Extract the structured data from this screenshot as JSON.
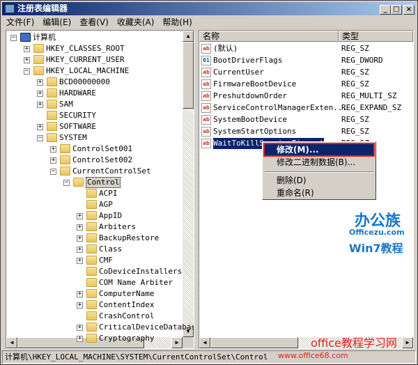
{
  "window": {
    "title": "注册表编辑器",
    "minimize": "_",
    "maximize": "□",
    "close": "×"
  },
  "menu": [
    "文件(F)",
    "编辑(E)",
    "查看(V)",
    "收藏夹(A)",
    "帮助(H)"
  ],
  "tree": [
    {
      "label": "计算机",
      "level": 0,
      "exp": "-",
      "type": "computer"
    },
    {
      "label": "HKEY_CLASSES_ROOT",
      "level": 1,
      "exp": "+"
    },
    {
      "label": "HKEY_CURRENT_USER",
      "level": 1,
      "exp": "+"
    },
    {
      "label": "HKEY_LOCAL_MACHINE",
      "level": 1,
      "exp": "-"
    },
    {
      "label": "BCD00000000",
      "level": 2,
      "exp": "+"
    },
    {
      "label": "HARDWARE",
      "level": 2,
      "exp": "+"
    },
    {
      "label": "SAM",
      "level": 2,
      "exp": "+"
    },
    {
      "label": "SECURITY",
      "level": 2,
      "exp": ""
    },
    {
      "label": "SOFTWARE",
      "level": 2,
      "exp": "+"
    },
    {
      "label": "SYSTEM",
      "level": 2,
      "exp": "-"
    },
    {
      "label": "ControlSet001",
      "level": 3,
      "exp": "+"
    },
    {
      "label": "ControlSet002",
      "level": 3,
      "exp": "+"
    },
    {
      "label": "CurrentControlSet",
      "level": 3,
      "exp": "-"
    },
    {
      "label": "Control",
      "level": 4,
      "exp": "-",
      "selected": true
    },
    {
      "label": "ACPI",
      "level": 5,
      "exp": ""
    },
    {
      "label": "AGP",
      "level": 5,
      "exp": ""
    },
    {
      "label": "AppID",
      "level": 5,
      "exp": "+"
    },
    {
      "label": "Arbiters",
      "level": 5,
      "exp": "+"
    },
    {
      "label": "BackupRestore",
      "level": 5,
      "exp": "+"
    },
    {
      "label": "Class",
      "level": 5,
      "exp": "+"
    },
    {
      "label": "CMF",
      "level": 5,
      "exp": "+"
    },
    {
      "label": "CoDeviceInstallers",
      "level": 5,
      "exp": ""
    },
    {
      "label": "COM Name Arbiter",
      "level": 5,
      "exp": ""
    },
    {
      "label": "ComputerName",
      "level": 5,
      "exp": "+"
    },
    {
      "label": "ContentIndex",
      "level": 5,
      "exp": "+"
    },
    {
      "label": "CrashControl",
      "level": 5,
      "exp": ""
    },
    {
      "label": "CriticalDeviceDatabase",
      "level": 5,
      "exp": "+"
    },
    {
      "label": "Cryptography",
      "level": 5,
      "exp": "+"
    }
  ],
  "list": {
    "columns": [
      "名称",
      "类型"
    ],
    "rows": [
      {
        "name": "(默认)",
        "type": "REG_SZ",
        "icon": "ab"
      },
      {
        "name": "BootDriverFlags",
        "type": "REG_DWORD",
        "icon": "bin"
      },
      {
        "name": "CurrentUser",
        "type": "REG_SZ",
        "icon": "ab"
      },
      {
        "name": "FirmwareBootDevice",
        "type": "REG_SZ",
        "icon": "ab"
      },
      {
        "name": "PreshutdownOrder",
        "type": "REG_MULTI_SZ",
        "icon": "ab"
      },
      {
        "name": "ServiceControlManagerExten...",
        "type": "REG_EXPAND_SZ",
        "icon": "ab"
      },
      {
        "name": "SystemBootDevice",
        "type": "REG_SZ",
        "icon": "ab"
      },
      {
        "name": "SystemStartOptions",
        "type": "REG_SZ",
        "icon": "ab"
      },
      {
        "name": "WaitToKillServiceTimeout",
        "type": "REG_SZ",
        "icon": "ab",
        "selected": true
      }
    ]
  },
  "context_menu": {
    "modify": "修改(M)...",
    "modify_binary": "修改二进制数据(B)...",
    "delete": "删除(D)",
    "rename": "重命名(R)"
  },
  "status": "计算机\\HKEY_LOCAL_MACHINE\\SYSTEM\\CurrentControlSet\\Control",
  "watermarks": {
    "brand1": "办公族",
    "brand1_url": "Officezu.com",
    "brand1_sub": "Win7教程",
    "brand2": "office教程学习网",
    "brand2_url": "www.office68.com"
  },
  "colors": {
    "selection": "#0a246a",
    "highlight_box": "#e0231d"
  }
}
